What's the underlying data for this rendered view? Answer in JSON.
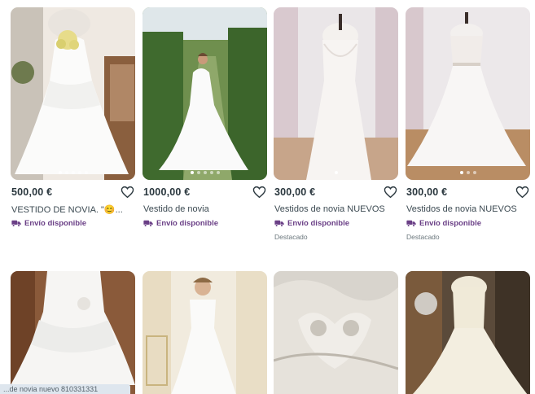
{
  "listings": [
    {
      "price": "500,00 €",
      "title": "VESTIDO DE NOVIA. \"😊...",
      "shipping": "Envío disponible",
      "featured": ""
    },
    {
      "price": "1000,00 €",
      "title": "Vestido de novia",
      "shipping": "Envío disponible",
      "featured": ""
    },
    {
      "price": "300,00 €",
      "title": "Vestidos de novia NUEVOS",
      "shipping": "Envío disponible",
      "featured": "Destacado"
    },
    {
      "price": "300,00 €",
      "title": "Vestidos de novia NUEVOS",
      "shipping": "Envío disponible",
      "featured": "Destacado"
    }
  ],
  "status_bar": {
    "text": "...de novia nuevo 810331331"
  },
  "icons": {
    "favorite": "heart-icon",
    "shipping": "truck-icon"
  },
  "colors": {
    "shipping_text": "#6a3f86",
    "price_text": "#29363d"
  }
}
